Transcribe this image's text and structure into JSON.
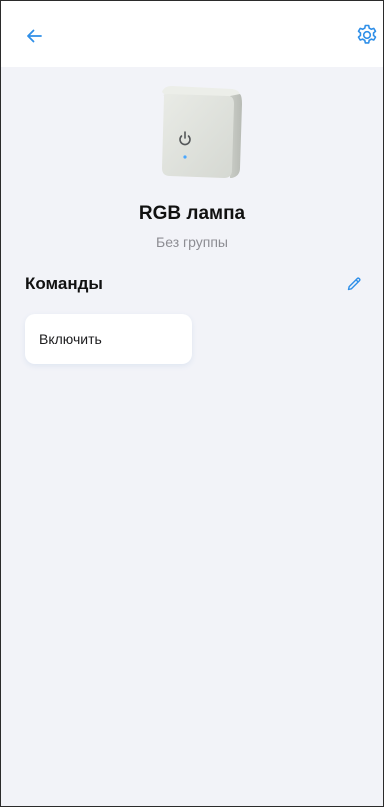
{
  "colors": {
    "accent": "#2f8fe8",
    "background": "#f2f3f8",
    "card": "#ffffff",
    "text_primary": "#111111",
    "text_secondary": "#8d8d93"
  },
  "header": {
    "back_icon": "arrow-left-icon",
    "settings_icon": "gear-icon"
  },
  "device": {
    "image": "smart-plug-device-image",
    "name": "RGB лампа",
    "group": "Без группы"
  },
  "commands": {
    "title": "Команды",
    "edit_icon": "pencil-icon",
    "items": [
      {
        "label": "Включить"
      }
    ]
  }
}
